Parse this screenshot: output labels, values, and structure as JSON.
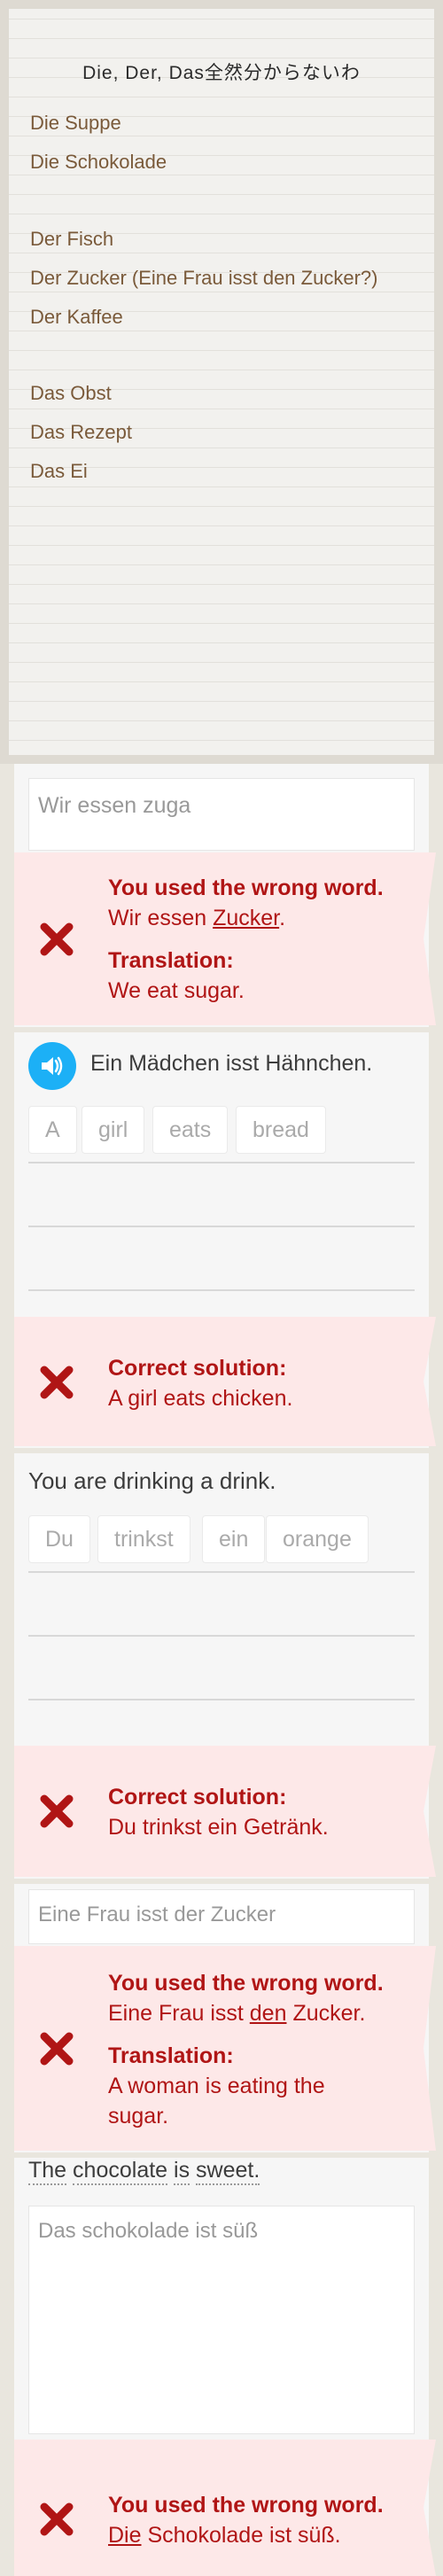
{
  "note": {
    "title": "Die, Der, Das全然分からないわ",
    "lines": [
      "Die Suppe",
      "Die Schokolade",
      "Der Fisch",
      "Der Zucker (Eine Frau isst den Zucker?)",
      "Der Kaffee",
      "Das Obst",
      "Das Rezept",
      "Das Ei"
    ]
  },
  "ex1": {
    "answer": "Wir essen zuga",
    "heading": "You used the wrong word.",
    "correct_before": "Wir essen ",
    "correct_word": "Zucker",
    "correct_after": ".",
    "translation_label": "Translation:",
    "translation": "We eat sugar."
  },
  "ex2": {
    "prompt": "Ein Mädchen isst Hähnchen.",
    "chips": [
      "A",
      "girl",
      "eats",
      "bread"
    ],
    "heading": "Correct solution:",
    "solution": "A girl eats chicken."
  },
  "ex3": {
    "prompt": "You are drinking a drink.",
    "chips": [
      "Du",
      "trinkst",
      "ein",
      "orange"
    ],
    "heading": "Correct solution:",
    "solution": "Du trinkst ein Getränk."
  },
  "ex4": {
    "answer": "Eine Frau isst der Zucker",
    "heading": "You used the wrong word.",
    "correct_before": "Eine Frau isst ",
    "correct_word": "den",
    "correct_after": " Zucker.",
    "translation_label": "Translation:",
    "translation_1": "A woman is eating the",
    "translation_2": "sugar."
  },
  "ex5": {
    "prompt_words": [
      "The",
      "chocolate",
      "is",
      "sweet."
    ],
    "answer": "Das schokolade ist süß",
    "heading": "You used the wrong word.",
    "correct_word": "Die",
    "correct_after": " Schokolade ist süß."
  },
  "colors": {
    "error": "#b01515",
    "error_bg": "#fde8e8",
    "speaker": "#1cb0f6"
  },
  "icons": {
    "wrong": "x-icon",
    "audio": "speaker-icon"
  }
}
